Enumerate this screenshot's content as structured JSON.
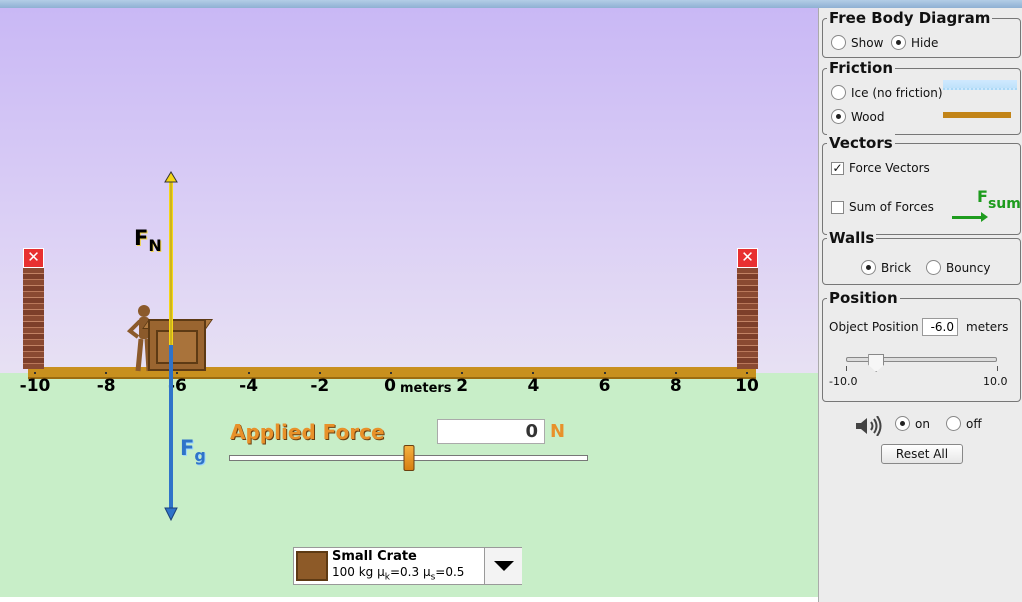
{
  "play_area": {
    "axis_ticks": [
      "-10",
      "-8",
      "-6",
      "-4",
      "-2",
      "0",
      "2",
      "4",
      "6",
      "8",
      "10"
    ],
    "axis_unit": "meters",
    "wall_close_symbol": "✕",
    "force_normal": {
      "label": "F",
      "sub": "N",
      "color": "#f5d617"
    },
    "force_gravity": {
      "label": "F",
      "sub": "g",
      "color": "#2f73c9"
    },
    "applied_force": {
      "title": "Applied Force",
      "value": "0",
      "unit": "N",
      "slider_fraction": 0.5
    },
    "object": {
      "name": "Small Crate",
      "mass": "100 kg",
      "mu_k_symbol": "μ",
      "mu_k_sub": "k",
      "mu_k_value": "=0.3",
      "mu_s_symbol": "μ",
      "mu_s_sub": "s",
      "mu_s_value": "=0.5"
    }
  },
  "control_panel": {
    "free_body": {
      "title": "Free Body Diagram",
      "show": "Show",
      "hide": "Hide",
      "selected": "hide"
    },
    "friction": {
      "title": "Friction",
      "ice": "Ice (no friction)",
      "wood": "Wood",
      "selected": "wood"
    },
    "vectors": {
      "title": "Vectors",
      "force_vectors": "Force Vectors",
      "force_vectors_checked": true,
      "sum_of_forces": "Sum of Forces",
      "sum_of_forces_checked": false,
      "fsum_label": "F",
      "fsum_sub": "sum"
    },
    "walls": {
      "title": "Walls",
      "brick": "Brick",
      "bouncy": "Bouncy",
      "selected": "brick"
    },
    "position": {
      "title": "Position",
      "label": "Object Position",
      "value": "-6.0",
      "unit": "meters",
      "min_label": "-10.0",
      "max_label": "10.0",
      "slider_value": -6.0
    },
    "sound": {
      "on": "on",
      "off": "off",
      "selected": "on"
    },
    "reset_label": "Reset All"
  },
  "colors": {
    "floor": "#c8901e",
    "sky_top": "#c9b8f5",
    "ground": "#c8eec8",
    "accent_orange": "#e8912a",
    "fsum_green": "#1e9c1e"
  }
}
